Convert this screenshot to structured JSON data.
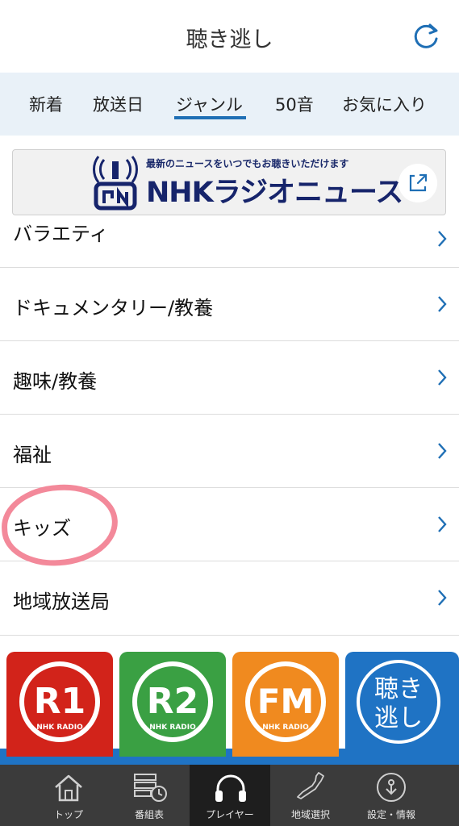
{
  "header": {
    "title": "聴き逃し",
    "refresh_icon": "refresh-icon"
  },
  "tabs": [
    {
      "label": "新着"
    },
    {
      "label": "放送日"
    },
    {
      "label": "ジャンル",
      "active": true
    },
    {
      "label": "50音"
    },
    {
      "label": "お気に入り"
    }
  ],
  "banner": {
    "tagline": "最新のニュースをいつでもお聴きいただけます",
    "brand": "NHKラジオニュース",
    "external_icon": "external-link-icon"
  },
  "genres": [
    {
      "label": "バラエティ"
    },
    {
      "label": "ドキュメンタリー/教養"
    },
    {
      "label": "趣味/教養"
    },
    {
      "label": "福祉"
    },
    {
      "label": "キッズ"
    },
    {
      "label": "地域放送局"
    }
  ],
  "stations": [
    {
      "mark": "R1",
      "sub": "NHK RADIO",
      "color": "#d2231a"
    },
    {
      "mark": "R2",
      "sub": "NHK RADIO",
      "color": "#3aa043"
    },
    {
      "mark": "FM",
      "sub": "NHK RADIO",
      "color": "#f08a1f"
    },
    {
      "mark_line1": "聴き",
      "mark_line2": "逃し",
      "color": "#1f73c4"
    }
  ],
  "tabbar": [
    {
      "label": "トップ",
      "icon": "home-icon"
    },
    {
      "label": "番組表",
      "icon": "schedule-icon"
    },
    {
      "label": "プレイヤー",
      "icon": "headphones-icon",
      "active": true
    },
    {
      "label": "地域選択",
      "icon": "japan-map-icon"
    },
    {
      "label": "設定・情報",
      "icon": "settings-info-icon"
    }
  ],
  "colors": {
    "accent": "#1f6fb5",
    "tab_bg": "#e9f1f8",
    "tabbar_bg": "#3b3b3b",
    "highlight": "#f3899a"
  }
}
